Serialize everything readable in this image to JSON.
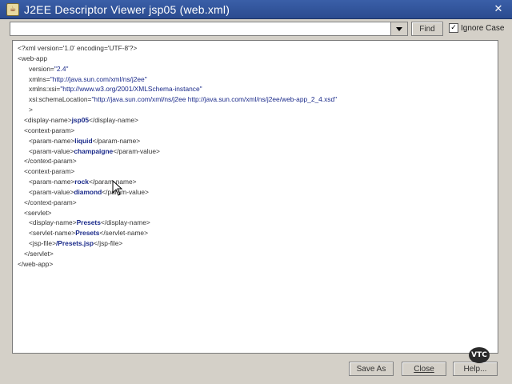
{
  "window": {
    "title": "J2EE Descriptor Viewer  jsp05 (web.xml)",
    "close_glyph": "✕",
    "app_icon": "java-cup-icon"
  },
  "toolbar": {
    "search_value": "",
    "find_label": "Find",
    "ignore_case_label": "Ignore Case",
    "ignore_case_checked": true
  },
  "xml_lines": [
    [
      {
        "c": "tag",
        "t": "<?xml version='1.0' encoding='UTF-8'?>"
      }
    ],
    [
      {
        "c": "tag",
        "t": "<web-app"
      }
    ],
    [
      {
        "c": "attr",
        "t": "version="
      },
      {
        "c": "val",
        "t": "\"2.4\""
      }
    ],
    [
      {
        "c": "attr",
        "t": "xmlns="
      },
      {
        "c": "val",
        "t": "\"http://java.sun.com/xml/ns/j2ee\""
      }
    ],
    [
      {
        "c": "attr",
        "t": "xmlns:xsi="
      },
      {
        "c": "val",
        "t": "\"http://www.w3.org/2001/XMLSchema-instance\""
      }
    ],
    [
      {
        "c": "attr",
        "t": "xsi:schemaLocation="
      },
      {
        "c": "val",
        "t": "\"http://java.sun.com/xml/ns/j2ee http://java.sun.com/xml/ns/j2ee/web-app_2_4.xsd\""
      }
    ],
    [
      {
        "c": "tag",
        "t": ">"
      }
    ],
    [
      {
        "c": "tag",
        "t": "<display-name>"
      },
      {
        "c": "txt",
        "t": "jsp05"
      },
      {
        "c": "tag",
        "t": "</display-name>"
      }
    ],
    [
      {
        "c": "tag",
        "t": "<context-param>"
      }
    ],
    [
      {
        "c": "tag",
        "t": "<param-name>"
      },
      {
        "c": "txt",
        "t": "liquid"
      },
      {
        "c": "tag",
        "t": "</param-name>"
      }
    ],
    [
      {
        "c": "tag",
        "t": "<param-value>"
      },
      {
        "c": "txt",
        "t": "champaigne"
      },
      {
        "c": "tag",
        "t": "</param-value>"
      }
    ],
    [
      {
        "c": "tag",
        "t": "</context-param>"
      }
    ],
    [
      {
        "c": "tag",
        "t": "<context-param>"
      }
    ],
    [
      {
        "c": "tag",
        "t": "<param-name>"
      },
      {
        "c": "txt",
        "t": "rock"
      },
      {
        "c": "tag",
        "t": "</param-name>"
      }
    ],
    [
      {
        "c": "tag",
        "t": "<param-value>"
      },
      {
        "c": "txt",
        "t": "diamond"
      },
      {
        "c": "tag",
        "t": "</param-value>"
      }
    ],
    [
      {
        "c": "tag",
        "t": "</context-param>"
      }
    ],
    [
      {
        "c": "tag",
        "t": "<servlet>"
      }
    ],
    [
      {
        "c": "tag",
        "t": "<display-name>"
      },
      {
        "c": "txt",
        "t": "Presets"
      },
      {
        "c": "tag",
        "t": "</display-name>"
      }
    ],
    [
      {
        "c": "tag",
        "t": "<servlet-name>"
      },
      {
        "c": "txt",
        "t": "Presets"
      },
      {
        "c": "tag",
        "t": "</servlet-name>"
      }
    ],
    [
      {
        "c": "tag",
        "t": "<jsp-file>"
      },
      {
        "c": "txt",
        "t": "/Presets.jsp"
      },
      {
        "c": "tag",
        "t": "</jsp-file>"
      }
    ],
    [
      {
        "c": "tag",
        "t": "</servlet>"
      }
    ],
    [
      {
        "c": "tag",
        "t": "</web-app>"
      }
    ]
  ],
  "buttons": {
    "save_as": "Save As",
    "close": "Close",
    "help": "Help..."
  },
  "logo_text": "VTC"
}
